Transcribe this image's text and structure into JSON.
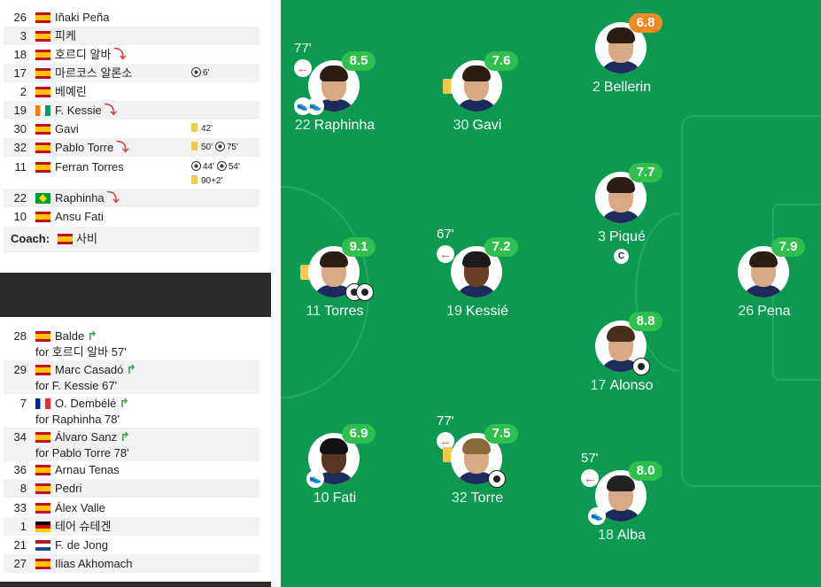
{
  "starters": [
    {
      "num": "26",
      "name": "Iñaki Peña",
      "flag": "es"
    },
    {
      "num": "3",
      "name": "피케",
      "flag": "es"
    },
    {
      "num": "18",
      "name": "호르디 알바",
      "flag": "es",
      "subbed_off": true
    },
    {
      "num": "17",
      "name": "마르코스 알론소",
      "flag": "es",
      "events": "6'"
    },
    {
      "num": "2",
      "name": "베예린",
      "flag": "es"
    },
    {
      "num": "19",
      "name": "F. Kessie",
      "flag": "ci",
      "subbed_off": true
    },
    {
      "num": "30",
      "name": "Gavi",
      "flag": "es",
      "events": "42'"
    },
    {
      "num": "32",
      "name": "Pablo Torre",
      "flag": "es",
      "subbed_off": true,
      "events_a": "50'",
      "events_b": "75'"
    },
    {
      "num": "11",
      "name": "Ferran Torres",
      "flag": "es",
      "events_a": "44'",
      "events_b": "54'",
      "events_c": "90+2'"
    },
    {
      "num": "22",
      "name": "Raphinha",
      "flag": "br",
      "subbed_off": true
    },
    {
      "num": "10",
      "name": "Ansu Fati",
      "flag": "es"
    }
  ],
  "coach": {
    "label": "Coach:",
    "name": "사비"
  },
  "substitutes": [
    {
      "num": "28",
      "name": "Balde",
      "flag": "es",
      "for": "for 호르디 알바 57'"
    },
    {
      "num": "29",
      "name": "Marc Casadó",
      "flag": "es",
      "for": "for F. Kessie 67'"
    },
    {
      "num": "7",
      "name": "O. Dembélé",
      "flag": "fr",
      "for": "for Raphinha 78'"
    },
    {
      "num": "34",
      "name": "Álvaro Sanz",
      "flag": "es",
      "for": "for Pablo Torre 78'"
    },
    {
      "num": "36",
      "name": "Arnau Tenas",
      "flag": "es"
    },
    {
      "num": "8",
      "name": "Pedri",
      "flag": "es"
    },
    {
      "num": "33",
      "name": "Álex Valle",
      "flag": "es"
    },
    {
      "num": "1",
      "name": "테어 슈테겐",
      "flag": "de"
    },
    {
      "num": "21",
      "name": "F. de Jong",
      "flag": "nl"
    },
    {
      "num": "27",
      "name": "Ilias Akhomach",
      "flag": "es"
    }
  ],
  "pitch": {
    "raphinha": {
      "num": "22",
      "name": "Raphinha",
      "rating": "8.5",
      "sub_time": "77'"
    },
    "gavi": {
      "num": "30",
      "name": "Gavi",
      "rating": "7.6"
    },
    "bellerin": {
      "num": "2",
      "name": "Bellerin",
      "rating": "6.8"
    },
    "torres": {
      "num": "11",
      "name": "Torres",
      "rating": "9.1"
    },
    "kessie": {
      "num": "19",
      "name": "Kessié",
      "rating": "7.2",
      "sub_time": "67'"
    },
    "pique": {
      "num": "3",
      "name": "Piqué",
      "rating": "7.7",
      "captain": "C"
    },
    "pena": {
      "num": "26",
      "name": "Pena",
      "rating": "7.9"
    },
    "alonso": {
      "num": "17",
      "name": "Alonso",
      "rating": "8.8"
    },
    "fati": {
      "num": "10",
      "name": "Fati",
      "rating": "6.9"
    },
    "torre": {
      "num": "32",
      "name": "Torre",
      "rating": "7.5",
      "sub_time": "77'"
    },
    "alba": {
      "num": "18",
      "name": "Alba",
      "rating": "8.0",
      "sub_time": "57'"
    }
  },
  "colors": {
    "pitch": "#0b9a4f",
    "rating_green": "#2fbf4f",
    "rating_orange": "#f08a24"
  }
}
